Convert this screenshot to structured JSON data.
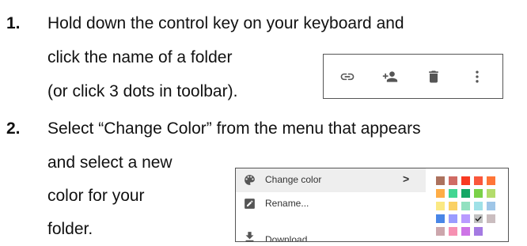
{
  "steps": [
    {
      "number": "1.",
      "lines": [
        "Hold down the control key on your keyboard and",
        "click the name of a folder",
        "(or click 3 dots in toolbar)."
      ]
    },
    {
      "number": "2.",
      "lines": [
        "Select “Change  Color” from the menu that appears",
        "and select a new",
        "color for your",
        "folder."
      ]
    }
  ],
  "toolbar": {
    "icons": [
      "link-icon",
      "add-person-icon",
      "trash-icon",
      "more-vert-icon"
    ]
  },
  "menu": {
    "items": [
      {
        "label": "Change color",
        "icon": "palette-icon",
        "submenu_indicator": ">"
      },
      {
        "label": "Rename...",
        "icon": "pencil-icon"
      },
      {
        "label": "Download",
        "icon": "download-icon"
      }
    ]
  },
  "palette": {
    "rows": [
      [
        "#ac725e",
        "#d06b64",
        "#f83a22",
        "#fa573c",
        "#ff7537"
      ],
      [
        "#ffad46",
        "#42d692",
        "#16a765",
        "#7bd148",
        "#b3dc6c"
      ],
      [
        "#fbe983",
        "#fad165",
        "#92e1c0",
        "#9fe1e7",
        "#9fc6e7"
      ],
      [
        "#4986e7",
        "#9a9cff",
        "#b99aff",
        "#c2c2c2",
        "#cabdbf"
      ],
      [
        "#cca6ac",
        "#f691b2",
        "#cd74e6",
        "#a47ae2"
      ]
    ],
    "selected": "#c2c2c2"
  }
}
